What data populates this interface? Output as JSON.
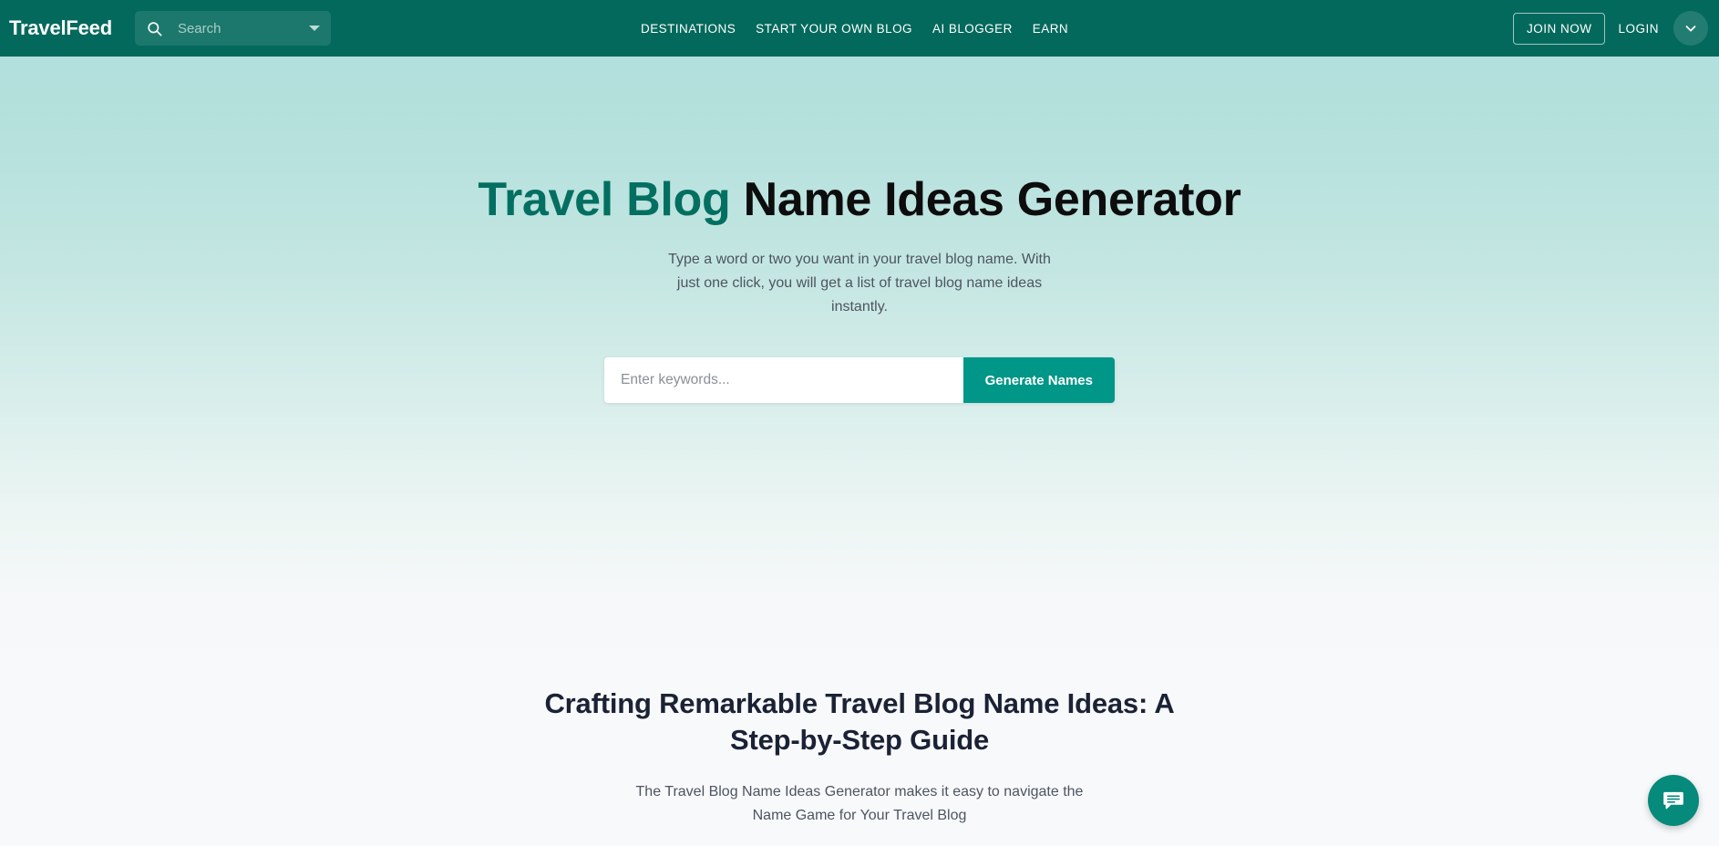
{
  "header": {
    "brand": "TravelFeed",
    "search": {
      "placeholder": "Search",
      "value": ""
    },
    "nav": [
      {
        "label": "DESTINATIONS"
      },
      {
        "label": "START YOUR OWN BLOG"
      },
      {
        "label": "AI BLOGGER"
      },
      {
        "label": "EARN"
      }
    ],
    "join_label": "JOIN NOW",
    "login_label": "LOGIN",
    "colors": {
      "bar": "#03695c",
      "text": "#ffffff"
    }
  },
  "hero": {
    "title_accent": "Travel Blog",
    "title_rest": " Name Ideas Generator",
    "subtitle": "Type a word or two you want in your travel blog name. With just one click, you will get a list of travel blog name ideas instantly.",
    "form": {
      "placeholder": "Enter keywords...",
      "value": "",
      "button_label": "Generate Names"
    },
    "colors": {
      "accent": "#036f61",
      "heading": "#0d0d0d",
      "gradient_top": "#b2e0dc",
      "gradient_bottom": "#f8f9fb"
    }
  },
  "guide": {
    "title": "Crafting Remarkable Travel Blog Name Ideas: A Step-by-Step Guide",
    "subtitle": "The Travel Blog Name Ideas Generator makes it easy to navigate the Name Game for Your Travel Blog",
    "colors": {
      "title": "#1b2235",
      "text": "#4d5560"
    }
  },
  "chat": {
    "icon": "chat-bubble-icon",
    "color": "#058a7c"
  }
}
